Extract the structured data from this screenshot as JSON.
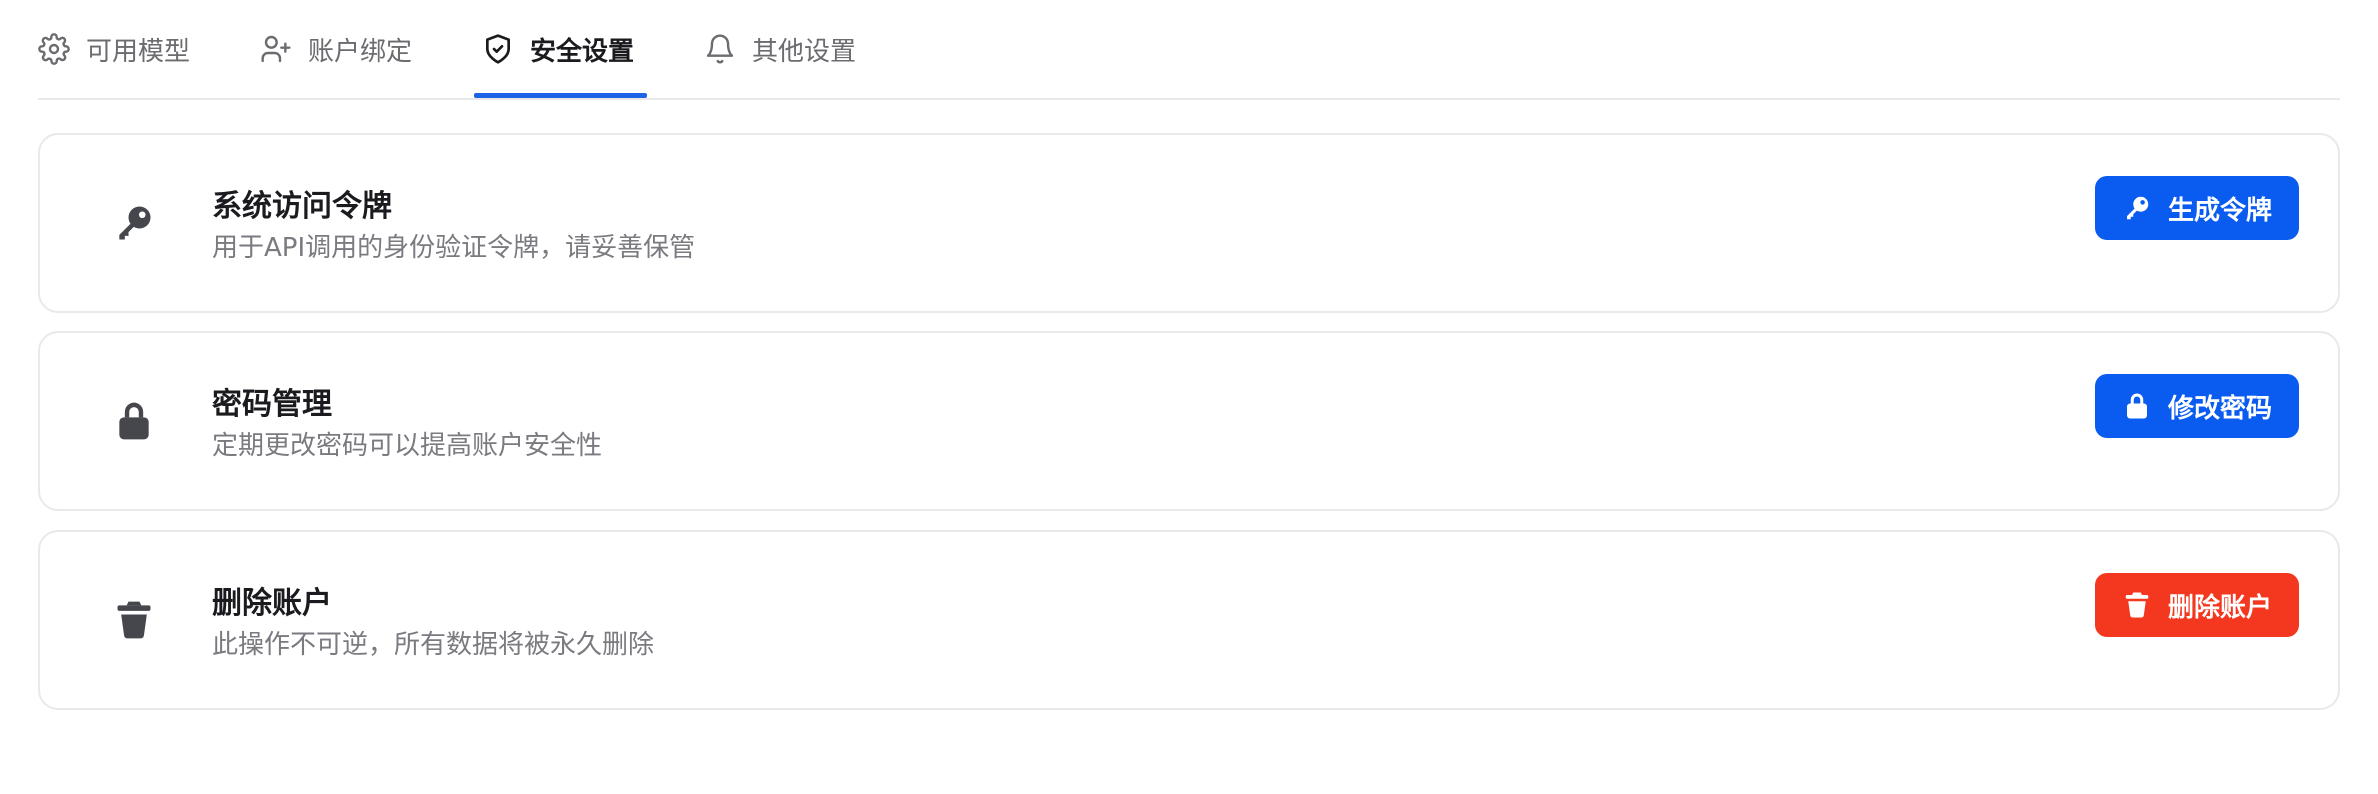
{
  "tabs": [
    {
      "label": "可用模型",
      "icon": "gear-icon",
      "active": false
    },
    {
      "label": "账户绑定",
      "icon": "user-plus-icon",
      "active": false
    },
    {
      "label": "安全设置",
      "icon": "shield-check-icon",
      "active": true
    },
    {
      "label": "其他设置",
      "icon": "bell-icon",
      "active": false
    }
  ],
  "cards": [
    {
      "title": "系统访问令牌",
      "description": "用于API调用的身份验证令牌，请妥善保管",
      "icon": "key-icon",
      "button_label": "生成令牌",
      "button_color": "#0a5cf0"
    },
    {
      "title": "密码管理",
      "description": "定期更改密码可以提高账户安全性",
      "icon": "lock-icon",
      "button_label": "修改密码",
      "button_color": "#0a5cf0"
    },
    {
      "title": "删除账户",
      "description": "此操作不可逆，所有数据将被永久删除",
      "icon": "trash-icon",
      "button_label": "删除账户",
      "button_color": "#f4381f"
    }
  ],
  "colors": {
    "accent": "#1d63e6",
    "primary_button": "#0a5cf0",
    "danger_button": "#f4381f"
  }
}
